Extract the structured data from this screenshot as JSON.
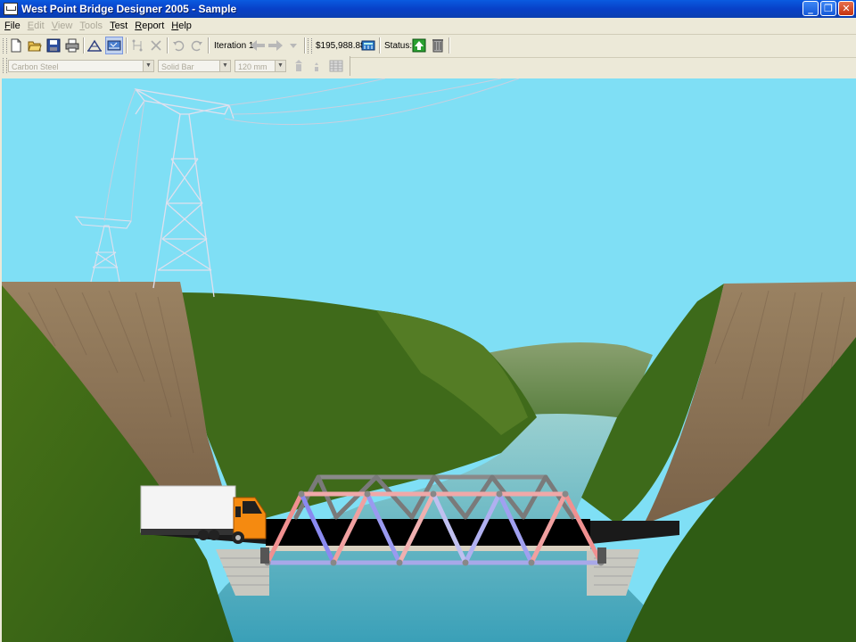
{
  "window": {
    "title": "West Point Bridge Designer 2005 - Sample",
    "buttons": [
      "_",
      "❐",
      "✕"
    ]
  },
  "menu": [
    {
      "label": "File",
      "enabled": true
    },
    {
      "label": "Edit",
      "enabled": false
    },
    {
      "label": "View",
      "enabled": false
    },
    {
      "label": "Tools",
      "enabled": false
    },
    {
      "label": "Test",
      "enabled": true
    },
    {
      "label": "Report",
      "enabled": true
    },
    {
      "label": "Help",
      "enabled": true
    }
  ],
  "toolbar": {
    "iteration_label": "Iteration 1",
    "cost": "$195,988.88",
    "status_label": "Status:",
    "icons": [
      "new-file-icon",
      "open-folder-icon",
      "save-icon",
      "print-icon",
      "draw-members-icon",
      "load-test-icon",
      "joints-icon",
      "delete-icon",
      "undo-icon",
      "redo-icon",
      "back-arrow-icon",
      "forward-arrow-icon",
      "iteration-dropdown-icon",
      "calculator-icon",
      "status-ok-icon",
      "trash-icon"
    ]
  },
  "member_toolbar": {
    "material": "Carbon Steel",
    "section": "Solid Bar",
    "size": "120 mm"
  },
  "colors": {
    "sky": "#7fdff5",
    "water": "#4fb0c0",
    "tension_member": "#f0a0a0",
    "compression_member": "#a0a0f0",
    "neutral_member": "#808080",
    "deck": "#000000",
    "truck_cab": "#f58a10"
  }
}
